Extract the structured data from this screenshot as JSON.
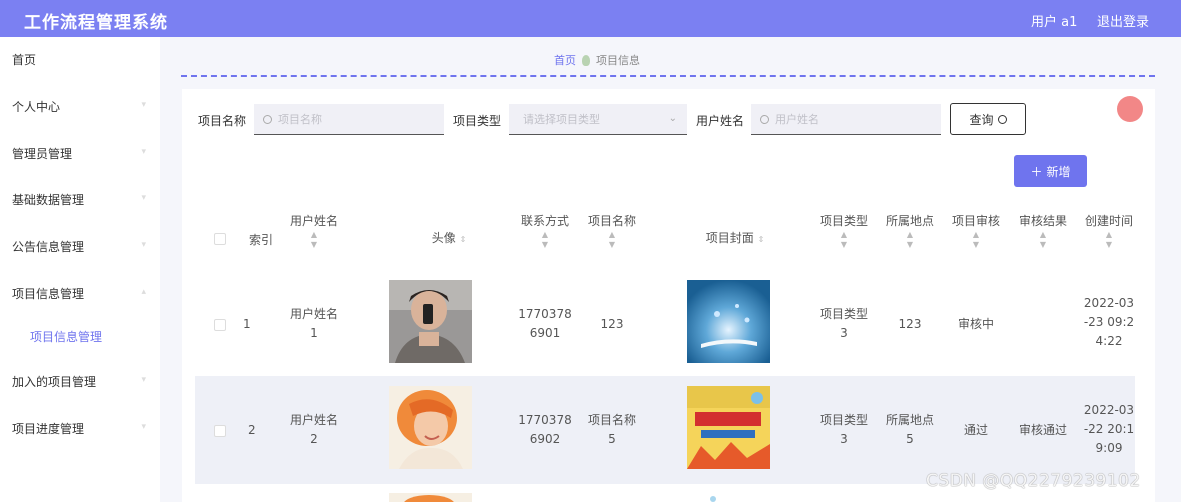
{
  "header": {
    "app_title": "工作流程管理系统",
    "user_label": "用户 a1",
    "logout_label": "退出登录"
  },
  "sidebar": {
    "items": [
      {
        "label": "首页"
      },
      {
        "label": "个人中心"
      },
      {
        "label": "管理员管理"
      },
      {
        "label": "基础数据管理"
      },
      {
        "label": "公告信息管理"
      },
      {
        "label": "项目信息管理"
      },
      {
        "label": "项目信息管理",
        "active": true
      },
      {
        "label": "加入的项目管理"
      },
      {
        "label": "项目进度管理"
      }
    ]
  },
  "breadcrumb": {
    "home": "首页",
    "current": "项目信息"
  },
  "search": {
    "project_name_label": "项目名称",
    "project_name_placeholder": "项目名称",
    "project_type_label": "项目类型",
    "project_type_placeholder": "请选择项目类型",
    "user_name_label": "用户姓名",
    "user_name_placeholder": "用户姓名",
    "query_label": "查询"
  },
  "actions": {
    "add_label": "新增"
  },
  "table": {
    "columns": [
      "索引",
      "用户姓名",
      "头像",
      "联系方式",
      "项目名称",
      "项目封面",
      "项目类型",
      "所属地点",
      "项目审核",
      "审核结果",
      "创建时间"
    ],
    "rows": [
      {
        "index": "1",
        "user_name": [
          "用户姓名",
          "1"
        ],
        "contact": [
          "1770378",
          "6901"
        ],
        "project_name": [
          "123"
        ],
        "project_type": [
          "项目类型",
          "3"
        ],
        "location": [
          "123"
        ],
        "audit": "审核中",
        "audit_result": "",
        "created": [
          "2022-03",
          "-23 09:2",
          "4:22"
        ]
      },
      {
        "index": "2",
        "user_name": [
          "用户姓名",
          "2"
        ],
        "contact": [
          "1770378",
          "6902"
        ],
        "project_name": [
          "项目名称",
          "5"
        ],
        "project_type": [
          "项目类型",
          "3"
        ],
        "location": [
          "所属地点",
          "5"
        ],
        "audit": "通过",
        "audit_result": "审核通过",
        "created": [
          "2022-03",
          "-22 20:1",
          "9:09"
        ]
      }
    ]
  },
  "watermark": "CSDN @QQ2279239102",
  "colors": {
    "accent": "#7b80f2",
    "link": "#6f74ee",
    "row_stripe": "#eef0f7"
  }
}
